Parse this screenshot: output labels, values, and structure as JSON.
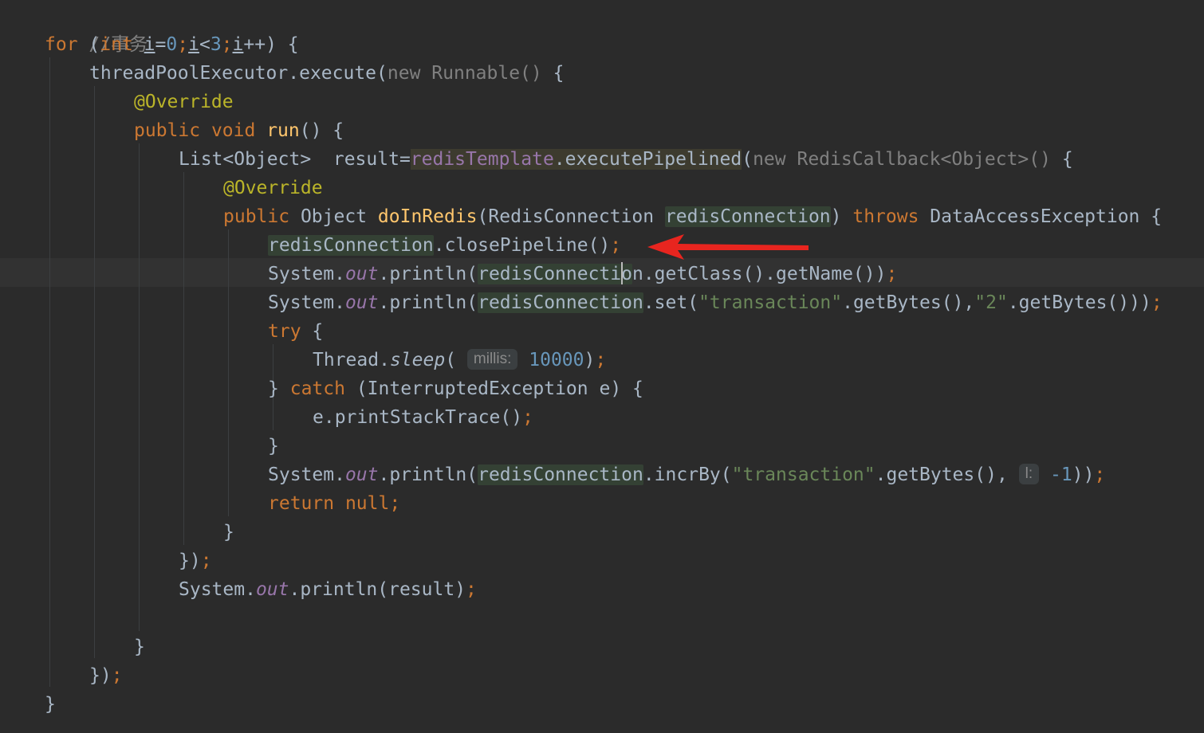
{
  "editor": {
    "comment": "//事务",
    "colors": {
      "background": "#2b2b2b",
      "keyword": "#cc7832",
      "annotation": "#bbb529",
      "number": "#6897bb",
      "string": "#6a8759",
      "field": "#9876aa",
      "arrow": "#e8251f"
    },
    "tokens": {
      "for_kw": "for",
      "int_kw": "int",
      "i": "i",
      "zero": "0",
      "three": "3",
      "new_kw": "new",
      "public_kw": "public",
      "void_kw": "void",
      "throws_kw": "throws",
      "try_kw": "try",
      "catch_kw": "catch",
      "return_kw": "return",
      "null_kw": "null",
      "override": "@Override",
      "runnable": "Runnable()",
      "thread_pool_execute": "threadPoolExecutor.execute(",
      "run_method": "run",
      "list_decl": "List<Object>  result=",
      "redis_template": "redisTemplate",
      "execute_pipelined": ".executePipelined",
      "redis_callback": "RedisCallback<Object>()",
      "object_type": "Object",
      "do_in_redis": "doInRedis",
      "redis_connection_type": "(RedisConnection ",
      "redis_connection": "redisConnection",
      "data_access_exception": " DataAccessException {",
      "close_pipeline": ".closePipeline()",
      "system": "System.",
      "out": "out",
      "println_open": ".println(",
      "get_class_name": "n.getClass().getName())",
      "redis_conn_before_caret": "redisConnecti",
      "redis_conn_after_caret": "o",
      "set_open": ".set(",
      "transaction_str": "\"transaction\"",
      "get_bytes_comma": ".getBytes(),",
      "two_str": "\"2\"",
      "get_bytes_close3": ".getBytes()))",
      "thread": "Thread.",
      "sleep": "sleep",
      "sleep_open": "( ",
      "millis_hint": "millis:",
      "ten_thousand": "10000",
      "close_paren": ")",
      "interrupted": "(InterruptedException e) {",
      "print_stack_trace": "e.printStackTrace()",
      "incr_by_open": ".incrBy(",
      "get_bytes_comma_space": ".getBytes(),",
      "l_hint": "l:",
      "minus_one": "-1",
      "close_parens2": "))",
      "println_result": ".println(result)",
      "semicolon": ";",
      "open_brace": " {",
      "close_brace": "}",
      "close_brace_paren": "})",
      "paren_open_brace": "() {",
      "space": " ",
      "paren": "(",
      "paren_close": ")",
      "close_paren_brace": "() {",
      "paren_brace_close": ") ",
      "lt": "<",
      "eq": "=",
      "incr": "++) {",
      "for_paren": " ("
    }
  }
}
